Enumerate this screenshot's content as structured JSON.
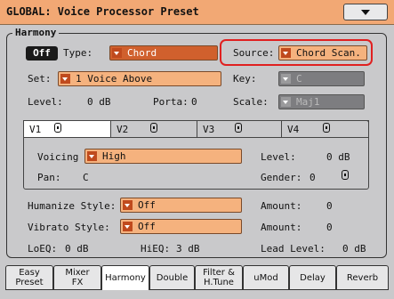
{
  "title": "GLOBAL: Voice Processor Preset",
  "section": "Harmony",
  "off_button": "Off",
  "type": {
    "label": "Type:",
    "value": "Chord"
  },
  "source": {
    "label": "Source:",
    "value": "Chord Scan."
  },
  "set": {
    "label": "Set:",
    "value": "1 Voice Above"
  },
  "key": {
    "label": "Key:",
    "value": "C"
  },
  "level": {
    "label": "Level:",
    "value": "0 dB"
  },
  "porta": {
    "label": "Porta:",
    "value": "0"
  },
  "scale": {
    "label": "Scale:",
    "value": "Maj1"
  },
  "voices": [
    {
      "label": "V1"
    },
    {
      "label": "V2"
    },
    {
      "label": "V3"
    },
    {
      "label": "V4"
    }
  ],
  "voicing": {
    "label": "Voicing",
    "value": "High"
  },
  "voice_level": {
    "label": "Level:",
    "value": "0 dB"
  },
  "pan": {
    "label": "Pan:",
    "value": "C"
  },
  "gender": {
    "label": "Gender:",
    "value": "0"
  },
  "humanize": {
    "label": "Humanize Style:",
    "value": "Off",
    "amount_label": "Amount:",
    "amount": "0"
  },
  "vibrato": {
    "label": "Vibrato Style:",
    "value": "Off",
    "amount_label": "Amount:",
    "amount": "0"
  },
  "loeq": {
    "label": "LoEQ:",
    "value": "0 dB"
  },
  "hieq": {
    "label": "HiEQ:",
    "value": "3 dB"
  },
  "lead_level": {
    "label": "Lead Level:",
    "value": "0 dB"
  },
  "tabs": [
    {
      "l1": "Easy",
      "l2": "Preset"
    },
    {
      "l1": "Mixer",
      "l2": "FX"
    },
    {
      "l1": "Harmony",
      "l2": ""
    },
    {
      "l1": "Double",
      "l2": ""
    },
    {
      "l1": "Filter &",
      "l2": "H.Tune"
    },
    {
      "l1": "uMod",
      "l2": ""
    },
    {
      "l1": "Delay",
      "l2": ""
    },
    {
      "l1": "Reverb",
      "l2": ""
    }
  ],
  "colors": {
    "title_bar": "#f2a874",
    "dropdown": "#f5b27e",
    "dropdown_selected": "#d0602d",
    "highlight": "#e02020"
  }
}
